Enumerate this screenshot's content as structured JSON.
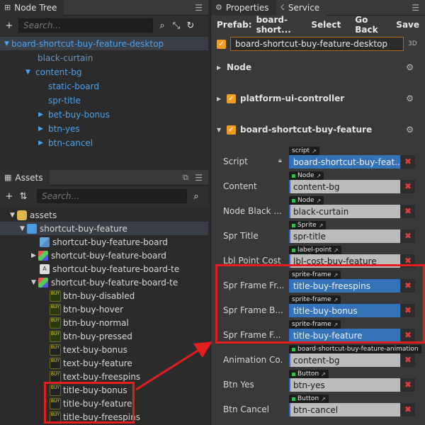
{
  "node_tree": {
    "tab_label": "Node Tree",
    "search_placeholder": "Search...",
    "items": [
      {
        "label": "board-shortcut-buy-feature-desktop"
      },
      {
        "label": "black-curtain"
      },
      {
        "label": "content-bg"
      },
      {
        "label": "static-board"
      },
      {
        "label": "spr-title"
      },
      {
        "label": "bet-buy-bonus"
      },
      {
        "label": "btn-yes"
      },
      {
        "label": "btn-cancel"
      }
    ]
  },
  "assets": {
    "tab_label": "Assets",
    "search_placeholder": "Search...",
    "items": [
      {
        "label": "assets"
      },
      {
        "label": "shortcut-buy-feature"
      },
      {
        "label": "shortcut-buy-feature-board"
      },
      {
        "label": "shortcut-buy-feature-board"
      },
      {
        "label": "shortcut-buy-feature-board-te"
      },
      {
        "label": "shortcut-buy-feature-board-te"
      },
      {
        "label": "btn-buy-disabled"
      },
      {
        "label": "btn-buy-hover"
      },
      {
        "label": "btn-buy-normal"
      },
      {
        "label": "btn-buy-pressed"
      },
      {
        "label": "text-buy-bonus"
      },
      {
        "label": "text-buy-feature"
      },
      {
        "label": "text-buy-freespins"
      },
      {
        "label": "title-buy-bonus"
      },
      {
        "label": "title-buy-feature"
      },
      {
        "label": "title-buy-freespins"
      }
    ]
  },
  "properties": {
    "tab_label": "Properties",
    "service_label": "Service",
    "prefab_label": "Prefab:",
    "prefab_name": "board-short...",
    "select_label": "Select",
    "goback_label": "Go Back",
    "save_label": "Save",
    "node_name": "board-shortcut-buy-feature-desktop",
    "three_d_label": "3D",
    "sections": {
      "node": "Node",
      "platform": "platform-ui-controller",
      "board": "board-shortcut-buy-feature"
    },
    "props": [
      {
        "label": "Script",
        "type": "script",
        "value": "board-shortcut-buy-feat..."
      },
      {
        "label": "Content",
        "type": "Node",
        "value": "content-bg"
      },
      {
        "label": "Node Black ...",
        "type": "Node",
        "value": "black-curtain"
      },
      {
        "label": "Spr Title",
        "type": "Sprite",
        "value": "spr-title"
      },
      {
        "label": "Lbl Point Cost",
        "type": "label-point",
        "value": "lbl-cost-buy-feature"
      },
      {
        "label": "Spr Frame Fr...",
        "type": "sprite-frame",
        "value": "title-buy-freespins"
      },
      {
        "label": "Spr Frame B...",
        "type": "sprite-frame",
        "value": "title-buy-bonus"
      },
      {
        "label": "Spr Frame F...",
        "type": "sprite-frame",
        "value": "title-buy-feature"
      },
      {
        "label": "Animation Co...",
        "type": "board-shortcut-buy-feature-animation",
        "value": "content-bg"
      },
      {
        "label": "Btn Yes",
        "type": "Button",
        "value": "btn-yes"
      },
      {
        "label": "Btn Cancel",
        "type": "Button",
        "value": "btn-cancel"
      }
    ]
  },
  "colors": {
    "accent_blue": "#4ba3f0",
    "highlight_red": "#e21e1e",
    "checkbox_orange": "#f29d1f"
  }
}
